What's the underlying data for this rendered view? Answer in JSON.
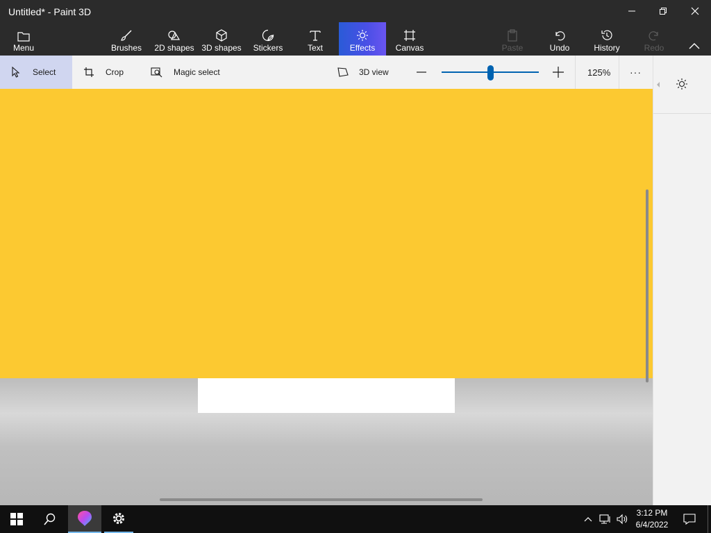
{
  "window": {
    "title": "Untitled* - Paint 3D"
  },
  "toolbar": {
    "menu": {
      "label": "Menu",
      "icon": "folder-icon"
    },
    "tools": [
      {
        "label": "Brushes",
        "icon": "brush-icon"
      },
      {
        "label": "2D shapes",
        "icon": "shapes-2d-icon"
      },
      {
        "label": "3D shapes",
        "icon": "cube-icon"
      },
      {
        "label": "Stickers",
        "icon": "sticker-icon"
      },
      {
        "label": "Text",
        "icon": "text-icon"
      },
      {
        "label": "Effects",
        "icon": "sun-icon",
        "selected": true
      },
      {
        "label": "Canvas",
        "icon": "canvas-icon"
      }
    ],
    "actions": [
      {
        "label": "Paste",
        "icon": "paste-icon",
        "enabled": false
      },
      {
        "label": "Undo",
        "icon": "undo-icon",
        "enabled": true
      },
      {
        "label": "History",
        "icon": "history-icon",
        "enabled": true
      },
      {
        "label": "Redo",
        "icon": "redo-icon",
        "enabled": false
      }
    ]
  },
  "subbar": {
    "select": "Select",
    "crop": "Crop",
    "magic_select": "Magic select",
    "view_3d": "3D view",
    "zoom_level": "125%",
    "zoom_fraction": 0.5,
    "more": "···"
  },
  "canvas": {
    "fill_color": "#fcc931",
    "background_color": "#ffffff"
  },
  "colors": {
    "accent": "#0063b1",
    "effects_active": "#4a4fe6",
    "titlebar": "#2b2b2b"
  },
  "taskbar": {
    "time": "3:12 PM",
    "date": "6/4/2022"
  }
}
